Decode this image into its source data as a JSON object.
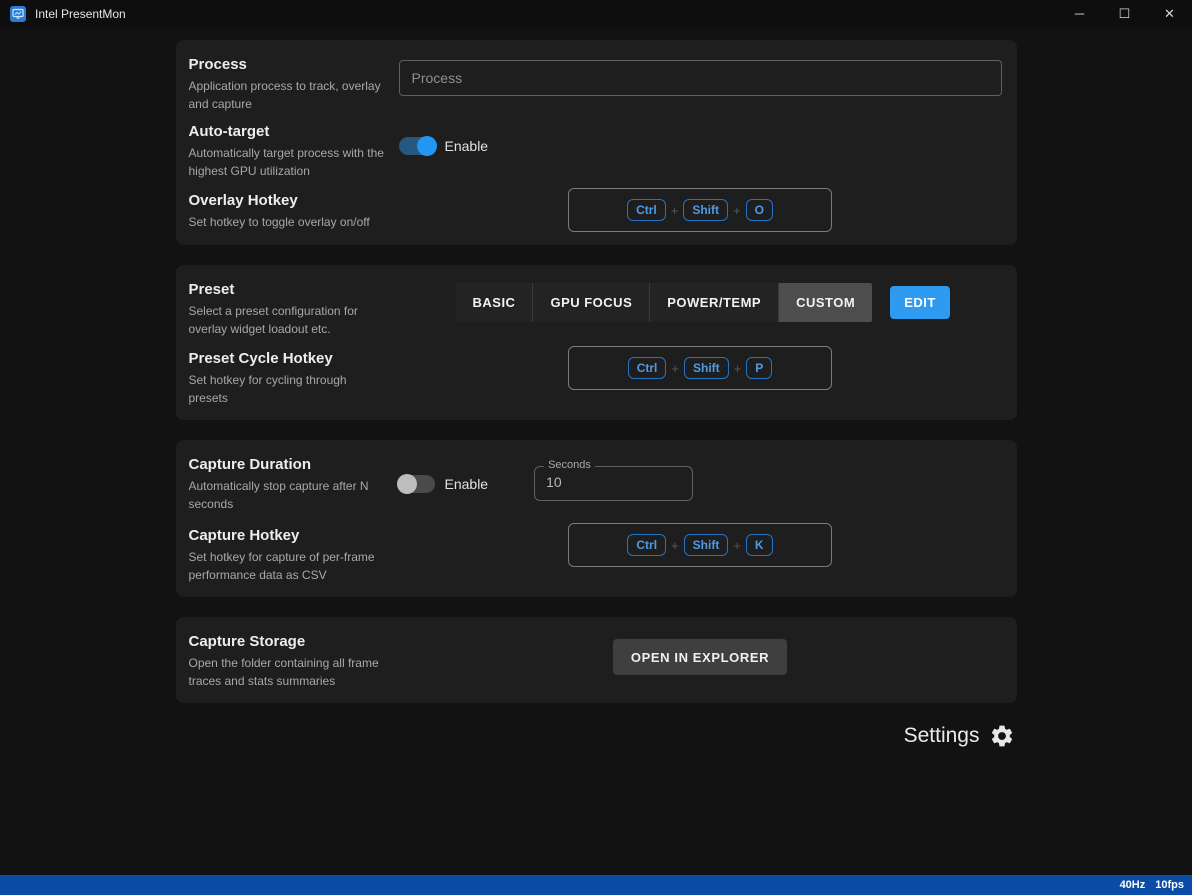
{
  "titlebar": {
    "title": "Intel PresentMon",
    "controls": {
      "minimize": "─",
      "maximize": "☐",
      "close": "✕"
    }
  },
  "common": {
    "plus": "+"
  },
  "process": {
    "heading": "Process",
    "description": "Application process to track, overlay and capture",
    "input_placeholder": "Process",
    "input_value": ""
  },
  "auto_target": {
    "heading": "Auto-target",
    "description": "Automatically target process with the highest GPU utilization",
    "toggle_label": "Enable",
    "toggle_state": "on"
  },
  "overlay_hotkey": {
    "heading": "Overlay Hotkey",
    "description": "Set hotkey to toggle overlay on/off",
    "keys": [
      "Ctrl",
      "Shift",
      "O"
    ]
  },
  "preset": {
    "heading": "Preset",
    "description": "Select a preset configuration for overlay widget loadout etc.",
    "options": [
      "BASIC",
      "GPU FOCUS",
      "POWER/TEMP",
      "CUSTOM"
    ],
    "selected": "CUSTOM",
    "edit_label": "EDIT"
  },
  "preset_cycle_hotkey": {
    "heading": "Preset Cycle Hotkey",
    "description": "Set hotkey for cycling through presets",
    "keys": [
      "Ctrl",
      "Shift",
      "P"
    ]
  },
  "capture_duration": {
    "heading": "Capture Duration",
    "description": "Automatically stop capture after N seconds",
    "toggle_label": "Enable",
    "toggle_state": "off",
    "seconds_label": "Seconds",
    "seconds_value": "10"
  },
  "capture_hotkey": {
    "heading": "Capture Hotkey",
    "description": "Set hotkey for capture of per-frame performance data as CSV",
    "keys": [
      "Ctrl",
      "Shift",
      "K"
    ]
  },
  "capture_storage": {
    "heading": "Capture Storage",
    "description": "Open the folder containing all frame traces and stats summaries",
    "button_label": "OPEN IN EXPLORER"
  },
  "settings": {
    "label": "Settings"
  },
  "statusbar": {
    "refresh_rate": "40Hz",
    "fps": "10fps"
  },
  "colors": {
    "accent_blue": "#2e9bf0",
    "toggle_on": "#2196f3",
    "key_text": "#4f9be5",
    "key_border": "#2273c4",
    "statusbar": "#0b4da6",
    "panel": "#1e1e1e",
    "background": "#121212"
  }
}
